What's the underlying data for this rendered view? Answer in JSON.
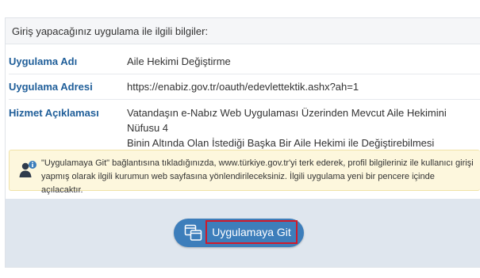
{
  "panel": {
    "header": "Giriş yapacağınız uygulama ile ilgili bilgiler:"
  },
  "rows": [
    {
      "label": "Uygulama Adı",
      "value": "Aile Hekimi Değiştirme"
    },
    {
      "label": "Uygulama Adresi",
      "value": "https://enabiz.gov.tr/oauth/edevlettektik.ashx?ah=1"
    },
    {
      "label": "Hizmet Açıklaması",
      "value_line1": "Vatandaşın e-Nabız Web Uygulaması Üzerinden Mevcut Aile Hekimini Nüfusu 4",
      "value_line2": "Binin Altında Olan İstediği Başka Bir Aile Hekimi ile Değiştirebilmesi"
    }
  ],
  "notice": {
    "icon": "user-info-icon",
    "line1": "\"Uygulamaya Git\" bağlantısına tıkladığınızda, www.türkiye.gov.tr'yi terk ederek, profil bilgileriniz ile kullanıcı girişi",
    "line2": "yapmış olarak ilgili kurumun web sayfasına yönlendirileceksiniz. İlgili uygulama yeni bir pencere içinde açılacaktır."
  },
  "button": {
    "label": "Uygulamaya Git",
    "icon": "external-window-icon"
  },
  "colors": {
    "label_blue": "#1f5e99",
    "button_blue": "#3d7ebb",
    "highlight_red": "#d0192a",
    "notice_bg": "#fdf7dd",
    "footer_bg": "#dfe6ee"
  }
}
